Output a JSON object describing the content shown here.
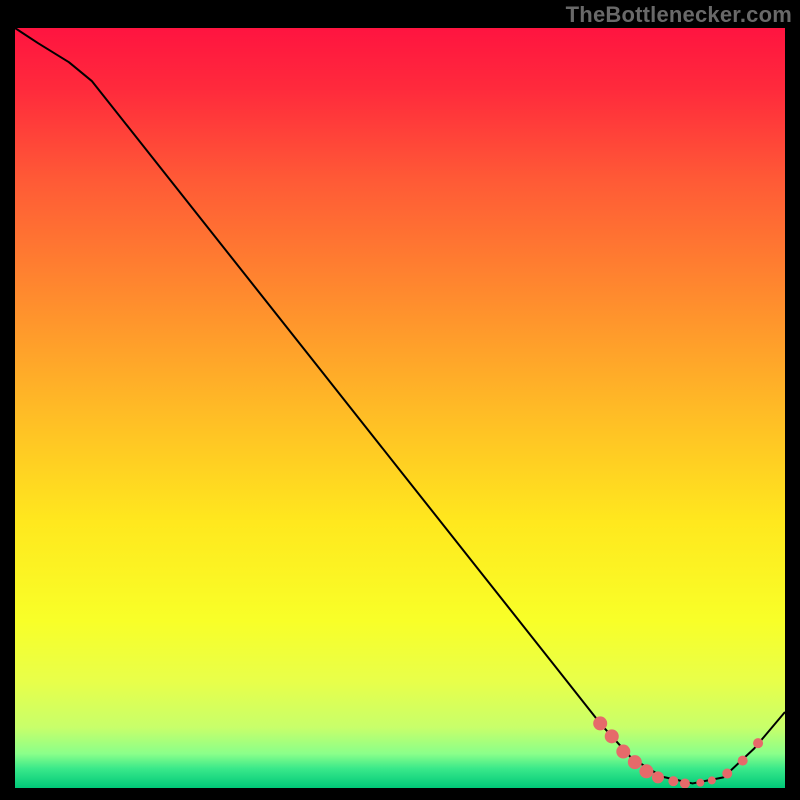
{
  "attribution": "TheBottlenecker.com",
  "chart_data": {
    "type": "line",
    "title": "",
    "xlabel": "",
    "ylabel": "",
    "xlim": [
      0,
      100
    ],
    "ylim": [
      0,
      100
    ],
    "background_gradient": {
      "stops": [
        {
          "offset": 0.0,
          "color": "#ff1440"
        },
        {
          "offset": 0.08,
          "color": "#ff2a3c"
        },
        {
          "offset": 0.2,
          "color": "#ff5a36"
        },
        {
          "offset": 0.35,
          "color": "#ff8a2e"
        },
        {
          "offset": 0.5,
          "color": "#ffba26"
        },
        {
          "offset": 0.65,
          "color": "#ffe81e"
        },
        {
          "offset": 0.78,
          "color": "#f8ff28"
        },
        {
          "offset": 0.86,
          "color": "#e8ff4a"
        },
        {
          "offset": 0.92,
          "color": "#c8ff6a"
        },
        {
          "offset": 0.955,
          "color": "#8aff8a"
        },
        {
          "offset": 0.975,
          "color": "#38e88a"
        },
        {
          "offset": 1.0,
          "color": "#00c878"
        }
      ]
    },
    "series": [
      {
        "name": "curve",
        "color": "#000000",
        "stroke_width": 2,
        "x": [
          0,
          3,
          7,
          10,
          20,
          30,
          40,
          50,
          60,
          70,
          76,
          80,
          84,
          88,
          92,
          96,
          100
        ],
        "y": [
          100,
          98,
          95.5,
          93,
          80.2,
          67.4,
          54.6,
          41.8,
          29.0,
          16.2,
          8.5,
          4.0,
          1.5,
          0.6,
          1.4,
          5.2,
          10.0
        ]
      }
    ],
    "markers": {
      "color": "#e66a6a",
      "points": [
        {
          "x": 76.0,
          "y": 8.5,
          "r": 7
        },
        {
          "x": 77.5,
          "y": 6.8,
          "r": 7
        },
        {
          "x": 79.0,
          "y": 4.8,
          "r": 7
        },
        {
          "x": 80.5,
          "y": 3.4,
          "r": 7
        },
        {
          "x": 82.0,
          "y": 2.2,
          "r": 7
        },
        {
          "x": 83.5,
          "y": 1.4,
          "r": 6
        },
        {
          "x": 85.5,
          "y": 0.9,
          "r": 5
        },
        {
          "x": 87.0,
          "y": 0.6,
          "r": 5
        },
        {
          "x": 89.0,
          "y": 0.7,
          "r": 4
        },
        {
          "x": 90.5,
          "y": 1.0,
          "r": 4
        },
        {
          "x": 92.5,
          "y": 1.9,
          "r": 5
        },
        {
          "x": 94.5,
          "y": 3.6,
          "r": 5
        },
        {
          "x": 96.5,
          "y": 5.9,
          "r": 5
        }
      ]
    }
  }
}
